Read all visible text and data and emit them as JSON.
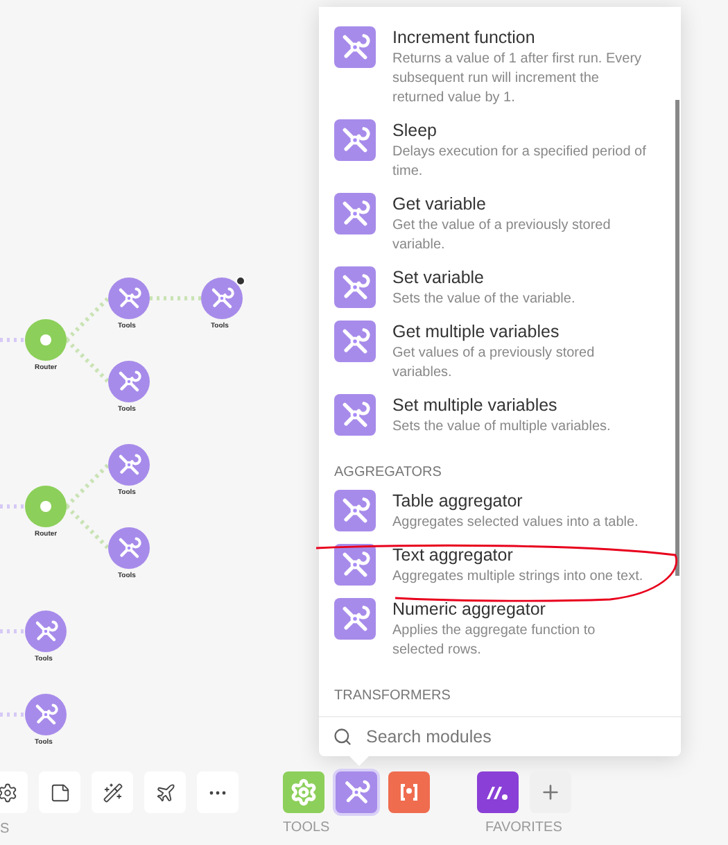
{
  "canvas": {
    "nodes": [
      {
        "kind": "tools",
        "label": "Tools",
        "badge": false
      },
      {
        "kind": "tools",
        "label": "Tools",
        "badge": true
      },
      {
        "kind": "router",
        "label": "Router",
        "badge": false
      },
      {
        "kind": "tools",
        "label": "Tools",
        "badge": false
      },
      {
        "kind": "tools",
        "label": "Tools",
        "badge": false
      },
      {
        "kind": "router",
        "label": "Router",
        "badge": false
      },
      {
        "kind": "tools",
        "label": "Tools",
        "badge": false
      },
      {
        "kind": "tools",
        "label": "Tools",
        "badge": false
      },
      {
        "kind": "tools",
        "label": "Tools",
        "badge": false
      }
    ]
  },
  "module_panel": {
    "entries": [
      {
        "kind": "item",
        "title": "Increment function",
        "description": "Returns a value of 1 after first run. Every subsequent run will increment the returned value by 1."
      },
      {
        "kind": "item",
        "title": "Sleep",
        "description": "Delays execution for a specified period of time."
      },
      {
        "kind": "item",
        "title": "Get variable",
        "description": "Get the value of a previously stored variable."
      },
      {
        "kind": "item",
        "title": "Set variable",
        "description": "Sets the value of the variable."
      },
      {
        "kind": "item",
        "title": "Get multiple variables",
        "description": "Get values of a previously stored variables."
      },
      {
        "kind": "item",
        "title": "Set multiple variables",
        "description": "Sets the value of multiple variables."
      },
      {
        "kind": "header",
        "title": "AGGREGATORS"
      },
      {
        "kind": "item",
        "title": "Table aggregator",
        "description": "Aggregates selected values into a table."
      },
      {
        "kind": "item",
        "title": "Text aggregator",
        "description": "Aggregates multiple strings into one text."
      },
      {
        "kind": "item",
        "title": "Numeric aggregator",
        "description": "Applies the aggregate function to selected rows."
      },
      {
        "kind": "header",
        "title": "TRANSFORMERS"
      }
    ],
    "search": {
      "placeholder": "Search modules"
    }
  },
  "toolbar": {
    "buttons": [
      {
        "kind": "settings"
      },
      {
        "kind": "note"
      },
      {
        "kind": "magic"
      },
      {
        "kind": "plane"
      },
      {
        "kind": "more"
      }
    ],
    "cut_label": "S",
    "groups": [
      {
        "label": "TOOLS",
        "items": [
          {
            "kind": "gear",
            "selected": false
          },
          {
            "kind": "tools",
            "selected": true
          },
          {
            "kind": "text",
            "selected": false
          }
        ]
      },
      {
        "label": "FAVORITES",
        "items": [
          {
            "kind": "logo",
            "selected": false
          },
          {
            "kind": "add",
            "selected": false
          }
        ]
      }
    ]
  }
}
